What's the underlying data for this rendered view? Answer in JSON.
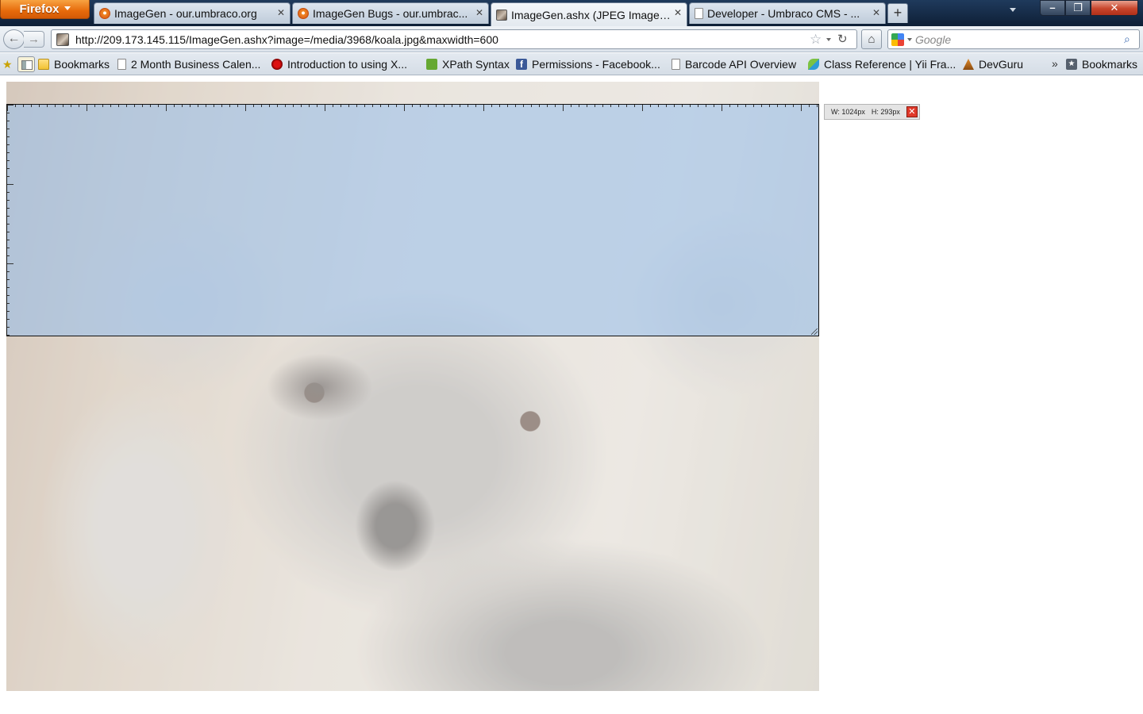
{
  "browser": {
    "menu_button": "Firefox",
    "tabs": [
      {
        "title": "ImageGen - our.umbraco.org",
        "icon": "umbraco-icon",
        "active": false
      },
      {
        "title": "ImageGen Bugs - our.umbrac...",
        "icon": "umbraco-icon",
        "active": false
      },
      {
        "title": "ImageGen.ashx (JPEG Image, ...",
        "icon": "koala-image-icon",
        "active": true
      },
      {
        "title": "Developer - Umbraco CMS - ...",
        "icon": "page-icon",
        "active": false
      }
    ],
    "new_tab": "+",
    "tab_close": "✕",
    "window_controls": {
      "minimize": "–",
      "restore": "❐",
      "close": "✕"
    }
  },
  "navbar": {
    "back": "←",
    "forward": "→",
    "url": "http://209.173.145.115/ImageGen.ashx?image=/media/3968/koala.jpg&maxwidth=600",
    "star": "☆",
    "reload": "↻",
    "home": "⌂",
    "search_placeholder": "Google",
    "search_glyph": "⌕"
  },
  "bookmarks": {
    "star": "★",
    "items": [
      {
        "label": "Bookmarks",
        "icon": "folder-icon"
      },
      {
        "label": "2 Month Business Calen...",
        "icon": "page-icon"
      },
      {
        "label": "Introduction to using X...",
        "icon": "red-bird-icon"
      },
      {
        "label": "XPath Syntax",
        "icon": "xpath-icon"
      },
      {
        "label": "Permissions - Facebook...",
        "icon": "facebook-icon",
        "glyph": "f"
      },
      {
        "label": "Barcode API Overview",
        "icon": "page-icon"
      },
      {
        "label": "Class Reference | Yii Fra...",
        "icon": "yii-icon"
      },
      {
        "label": "DevGuru",
        "icon": "devguru-icon"
      }
    ],
    "overflow": "»",
    "end_folder": {
      "label": "Bookmarks",
      "icon": "bookmarks-menu-icon"
    }
  },
  "measure": {
    "width_label": "W: 1024px",
    "height_label": "H: 293px",
    "close": "✕"
  }
}
